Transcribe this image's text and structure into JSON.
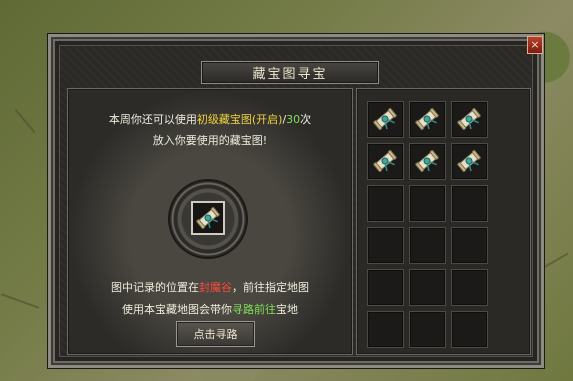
{
  "window": {
    "title": "藏宝图寻宝",
    "close_glyph": "×"
  },
  "info": {
    "line1": {
      "prefix": "本周你还可以使用",
      "item": "初级藏宝图(开启)",
      "sep": "/",
      "count": "30",
      "suffix": "次"
    },
    "line2": "放入你要使用的藏宝图!",
    "line3": {
      "prefix": "图中记录的位置在",
      "place": "封魔谷",
      "suffix": "，前往指定地图"
    },
    "line4": {
      "prefix": "使用本宝藏地图会带你",
      "action": "寻路前往",
      "suffix": "宝地"
    }
  },
  "button_label": "点击寻路",
  "center_slot": {
    "item": "treasure-map-scroll-icon"
  },
  "inventory": {
    "rows": 6,
    "cols": 3,
    "items": [
      "treasure-map-scroll-icon",
      "treasure-map-scroll-icon",
      "treasure-map-scroll-icon",
      "treasure-map-scroll-icon",
      "treasure-map-scroll-icon",
      "treasure-map-scroll-icon",
      "",
      "",
      "",
      "",
      "",
      "",
      "",
      "",
      "",
      "",
      "",
      ""
    ]
  },
  "colors": {
    "highlight_yellow": "#f0d23c",
    "highlight_green": "#7ee25a",
    "highlight_red": "#ff4a3a"
  }
}
